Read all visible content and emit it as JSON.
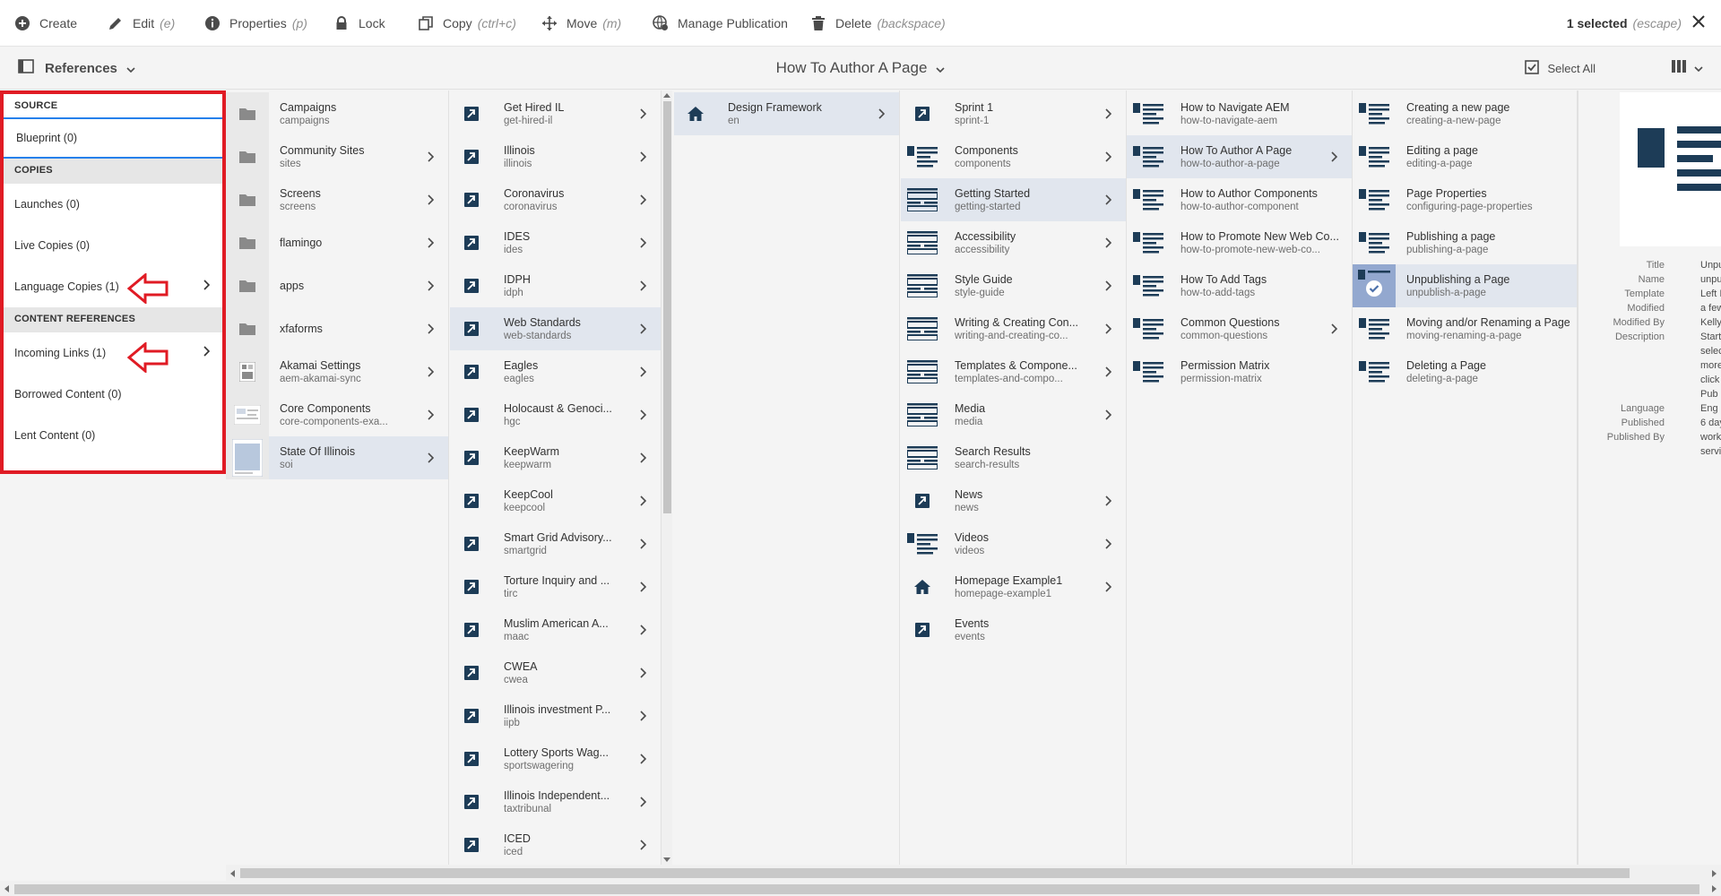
{
  "toolbar": {
    "create": "Create",
    "edit": "Edit",
    "edit_sc": "(e)",
    "properties": "Properties",
    "properties_sc": "(p)",
    "lock": "Lock",
    "copy": "Copy",
    "copy_sc": "(ctrl+c)",
    "move": "Move",
    "move_sc": "(m)",
    "manage_publication": "Manage Publication",
    "delete": "Delete",
    "delete_sc": "(backspace)",
    "selected": "1 selected",
    "escape": "(escape)"
  },
  "subbar": {
    "references": "References",
    "page_title": "How To Author A Page",
    "select_all": "Select All"
  },
  "references_panel": {
    "source": "SOURCE",
    "blueprint": "Blueprint (0)",
    "copies": "COPIES",
    "launches": "Launches (0)",
    "live_copies": "Live Copies (0)",
    "language_copies": "Language Copies (1)",
    "content_references": "CONTENT REFERENCES",
    "incoming_links": "Incoming Links (1)",
    "borrowed_content": "Borrowed Content (0)",
    "lent_content": "Lent Content (0)"
  },
  "colors": {
    "highlight_red": "#e01b24",
    "selected_row": "#e1e6ee",
    "accent_blue": "#2680eb",
    "icon_dark": "#1d3c57"
  },
  "columns": [
    {
      "items": [
        {
          "title": "Campaigns",
          "name": "campaigns",
          "icon": "folder-icon",
          "chevron": false
        },
        {
          "title": "Community Sites",
          "name": "sites",
          "icon": "folder-icon",
          "chevron": true
        },
        {
          "title": "Screens",
          "name": "screens",
          "icon": "folder-icon",
          "chevron": true
        },
        {
          "title": "flamingo",
          "name": "",
          "icon": "folder-icon",
          "chevron": true
        },
        {
          "title": "apps",
          "name": "",
          "icon": "folder-icon",
          "chevron": true
        },
        {
          "title": "xfaforms",
          "name": "",
          "icon": "folder-icon",
          "chevron": true
        },
        {
          "title": "Akamai Settings",
          "name": "aem-akamai-sync",
          "icon": "settings-page-icon",
          "chevron": true
        },
        {
          "title": "Core Components",
          "name": "core-components-exa...",
          "icon": "components-thumb-icon",
          "chevron": true
        },
        {
          "title": "State Of Illinois",
          "name": "soi",
          "icon": "page-thumb-icon",
          "chevron": true,
          "selected": true
        }
      ]
    },
    {
      "items": [
        {
          "title": "Get Hired IL",
          "name": "get-hired-il",
          "icon": "redirect-icon",
          "chevron": true
        },
        {
          "title": "Illinois",
          "name": "illinois",
          "icon": "redirect-icon",
          "chevron": true
        },
        {
          "title": "Coronavirus",
          "name": "coronavirus",
          "icon": "redirect-icon",
          "chevron": true
        },
        {
          "title": "IDES",
          "name": "ides",
          "icon": "redirect-icon",
          "chevron": true
        },
        {
          "title": "IDPH",
          "name": "idph",
          "icon": "redirect-icon",
          "chevron": true
        },
        {
          "title": "Web Standards",
          "name": "web-standards",
          "icon": "redirect-icon",
          "chevron": true,
          "selected": true
        },
        {
          "title": "Eagles",
          "name": "eagles",
          "icon": "redirect-icon",
          "chevron": true
        },
        {
          "title": "Holocaust & Genoci...",
          "name": "hgc",
          "icon": "redirect-icon",
          "chevron": true
        },
        {
          "title": "KeepWarm",
          "name": "keepwarm",
          "icon": "redirect-icon",
          "chevron": true
        },
        {
          "title": "KeepCool",
          "name": "keepcool",
          "icon": "redirect-icon",
          "chevron": true
        },
        {
          "title": "Smart Grid Advisory...",
          "name": "smartgrid",
          "icon": "redirect-icon",
          "chevron": true
        },
        {
          "title": "Torture Inquiry and ...",
          "name": "tirc",
          "icon": "redirect-icon",
          "chevron": true
        },
        {
          "title": "Muslim American A...",
          "name": "maac",
          "icon": "redirect-icon",
          "chevron": true
        },
        {
          "title": "CWEA",
          "name": "cwea",
          "icon": "redirect-icon",
          "chevron": true
        },
        {
          "title": "Illinois investment P...",
          "name": "iipb",
          "icon": "redirect-icon",
          "chevron": true
        },
        {
          "title": "Lottery Sports Wag...",
          "name": "sportswagering",
          "icon": "redirect-icon",
          "chevron": true
        },
        {
          "title": "Illinois Independent...",
          "name": "taxtribunal",
          "icon": "redirect-icon",
          "chevron": true
        },
        {
          "title": "ICED",
          "name": "iced",
          "icon": "redirect-icon",
          "chevron": true
        }
      ]
    },
    {
      "items": [
        {
          "title": "Design Framework",
          "name": "en",
          "icon": "home-icon",
          "chevron": true,
          "selected": true
        }
      ]
    },
    {
      "items": [
        {
          "title": "Sprint 1",
          "name": "sprint-1",
          "icon": "redirect-icon",
          "chevron": true
        },
        {
          "title": "Components",
          "name": "components",
          "icon": "article-template-icon",
          "chevron": true
        },
        {
          "title": "Getting Started",
          "name": "getting-started",
          "icon": "landing-template-icon",
          "chevron": true,
          "selected": true
        },
        {
          "title": "Accessibility",
          "name": "accessibility",
          "icon": "landing-template-icon",
          "chevron": true
        },
        {
          "title": "Style Guide",
          "name": "style-guide",
          "icon": "landing-template-icon",
          "chevron": true
        },
        {
          "title": "Writing & Creating Con...",
          "name": "writing-and-creating-co...",
          "icon": "landing-template-icon",
          "chevron": true
        },
        {
          "title": "Templates & Compone...",
          "name": "templates-and-compo...",
          "icon": "landing-template-icon",
          "chevron": true
        },
        {
          "title": "Media",
          "name": "media",
          "icon": "landing-template-icon",
          "chevron": true
        },
        {
          "title": "Search Results",
          "name": "search-results",
          "icon": "landing-template-icon",
          "chevron": false
        },
        {
          "title": "News",
          "name": "news",
          "icon": "redirect-icon",
          "chevron": true
        },
        {
          "title": "Videos",
          "name": "videos",
          "icon": "article-template-icon",
          "chevron": true
        },
        {
          "title": "Homepage Example1",
          "name": "homepage-example1",
          "icon": "home-icon",
          "chevron": true
        },
        {
          "title": "Events",
          "name": "events",
          "icon": "redirect-icon",
          "chevron": false
        }
      ]
    },
    {
      "items": [
        {
          "title": "How to Navigate AEM",
          "name": "how-to-navigate-aem",
          "icon": "article-template-icon",
          "chevron": false
        },
        {
          "title": "How To Author A Page",
          "name": "how-to-author-a-page",
          "icon": "article-template-icon",
          "chevron": true,
          "selected": true
        },
        {
          "title": "How to Author Components",
          "name": "how-to-author-component",
          "icon": "article-template-icon",
          "chevron": false
        },
        {
          "title": "How to Promote New Web Co...",
          "name": "how-to-promote-new-web-co...",
          "icon": "article-template-icon",
          "chevron": false
        },
        {
          "title": "How To Add Tags",
          "name": "how-to-add-tags",
          "icon": "article-template-icon",
          "chevron": false
        },
        {
          "title": "Common Questions",
          "name": "common-questions",
          "icon": "article-template-icon",
          "chevron": true
        },
        {
          "title": "Permission Matrix",
          "name": "permission-matrix",
          "icon": "article-template-icon",
          "chevron": false
        }
      ]
    },
    {
      "items": [
        {
          "title": "Creating a new page",
          "name": "creating-a-new-page",
          "icon": "article-template-icon",
          "chevron": false
        },
        {
          "title": "Editing a page",
          "name": "editing-a-page",
          "icon": "article-template-icon",
          "chevron": false
        },
        {
          "title": "Page Properties",
          "name": "configuring-page-properties",
          "icon": "article-template-icon",
          "chevron": false
        },
        {
          "title": "Publishing a page",
          "name": "publishing-a-page",
          "icon": "article-template-icon",
          "chevron": false
        },
        {
          "title": "Unpublishing a Page",
          "name": "unpublish-a-page",
          "icon": "checked-thumb-icon",
          "chevron": false,
          "selected": true
        },
        {
          "title": "Moving and/or Renaming a Page",
          "name": "moving-renaming-a-page",
          "icon": "article-template-icon",
          "chevron": false
        },
        {
          "title": "Deleting a Page",
          "name": "deleting-a-page",
          "icon": "article-template-icon",
          "chevron": false
        }
      ]
    }
  ],
  "preview": {
    "labels": [
      "Title",
      "Name",
      "Template",
      "Modified",
      "Modified By",
      "Description",
      "Language",
      "Published",
      "Published By"
    ],
    "values": [
      "Unpu",
      "unpu",
      "Left I",
      "a few",
      "Kelly",
      "Start",
      "Eng",
      "6 day",
      "work"
    ],
    "desc_lines": [
      "selec",
      "more",
      "click",
      "Pub"
    ],
    "pubby_line2": "servi"
  }
}
